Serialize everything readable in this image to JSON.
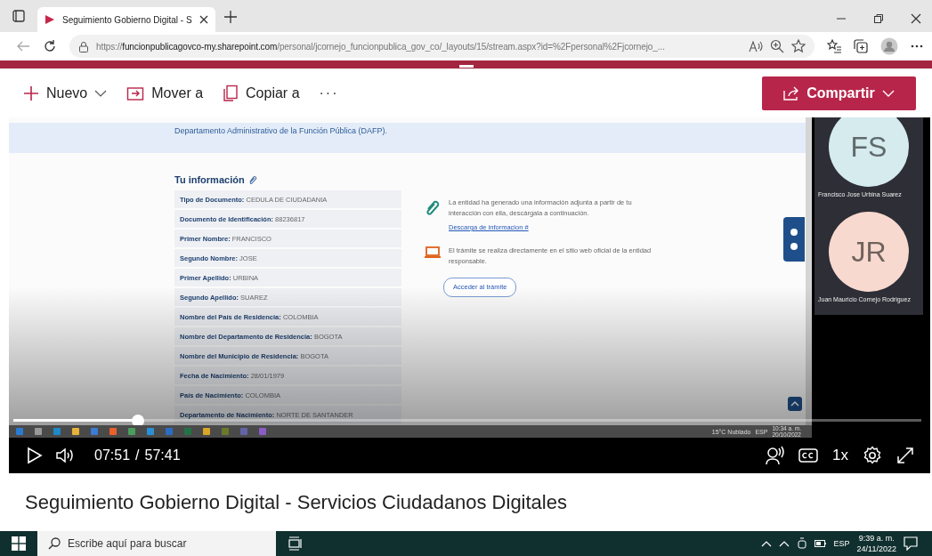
{
  "browser": {
    "tab_title": "Seguimiento Gobierno Digital - S",
    "url_scheme": "https://",
    "url_host": "funcionpublicagovco-my.sharepoint.com",
    "url_path": "/personal/jcornejo_funcionpublica_gov_co/_layouts/15/stream.aspx?id=%2Fpersonal%2Fjcornejo_..."
  },
  "commands": [
    {
      "label": "Nuevo",
      "has_menu": true
    },
    {
      "label": "Mover a",
      "has_menu": false
    },
    {
      "label": "Copiar a",
      "has_menu": false
    }
  ],
  "more_button": "···",
  "share_button": {
    "label": "Compartir"
  },
  "video": {
    "recording": {
      "banner": "Departamento Administrativo de la Función Pública (DAFP).",
      "section_title": "Tu información",
      "fields": [
        {
          "label": "Tipo de Documento:",
          "value": "CEDULA DE CIUDADANIA"
        },
        {
          "label": "Documento de Identificación:",
          "value": "88236817"
        },
        {
          "label": "Primer Nombre:",
          "value": "FRANCISCO"
        },
        {
          "label": "Segundo Nombre:",
          "value": "JOSE"
        },
        {
          "label": "Primer Apellido:",
          "value": "URBINA"
        },
        {
          "label": "Segundo Apellido:",
          "value": "SUAREZ"
        },
        {
          "label": "Nombre del País de Residencia:",
          "value": "COLOMBIA"
        },
        {
          "label": "Nombre del Departamento de Residencia:",
          "value": "BOGOTA"
        },
        {
          "label": "Nombre del Municipio de Residencia:",
          "value": "BOGOTA"
        },
        {
          "label": "Fecha de Nacimiento:",
          "value": "28/01/1979"
        },
        {
          "label": "País de Nacimiento:",
          "value": "COLOMBIA"
        },
        {
          "label": "Departamento de Nacimiento:",
          "value": "NORTE DE SANTANDER"
        }
      ],
      "notices": [
        {
          "kind": "attachment",
          "text": "La entidad ha generado una información adjunta a partir de tu interacción con ella, descárgala a continuación.",
          "link": "Descarga de informacion #"
        },
        {
          "kind": "online",
          "text": "El trámite se realiza directamente en el sitio web oficial de la entidad responsable.",
          "button": "Acceder al trámite"
        }
      ],
      "participants": [
        {
          "initials": "FS",
          "name": "Francisco Jose Urbina Suarez",
          "color": "#d5ebee"
        },
        {
          "initials": "JR",
          "name": "Juan Mauricio Cornejo Rodriguez",
          "color": "#f8d9cf"
        }
      ],
      "taskbar": {
        "weather": "15°C Nublado",
        "lang": "ESP",
        "time": "10:34 a. m.",
        "date": "20/10/2022"
      }
    },
    "progress": {
      "level": 0.137
    },
    "time_current": "07:51",
    "time_separator": "/",
    "time_total": "57:41",
    "speed": "1x"
  },
  "title": "Seguimiento Gobierno Digital - Servicios Ciudadanos Digitales",
  "taskbar": {
    "search_placeholder": "Escribe aquí para buscar",
    "lang": "ESP",
    "time": "9:39 a. m.",
    "date": "24/11/2022"
  }
}
